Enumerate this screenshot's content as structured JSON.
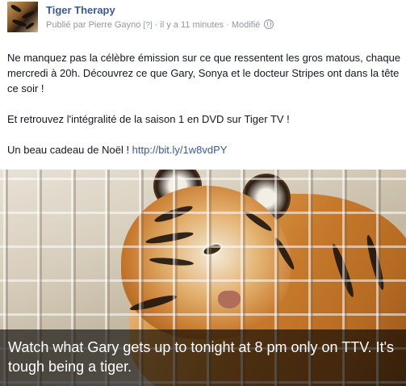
{
  "post": {
    "page_name": "Tiger Therapy",
    "published_by": "Publié par Pierre Gayno",
    "help_marker": "[?]",
    "time": "· il y a 11 minutes",
    "edited": "· Modifié",
    "privacy_icon": "globe-icon"
  },
  "body": {
    "paragraph_1": "Ne manquez pas la célèbre émission sur ce que ressentent les gros matous, chaque mercredi à 20h. Découvrez ce que Gary, Sonya et le docteur Stripes ont dans la tête ce soir !",
    "paragraph_2": "Et retrouvez l'intégralité de la saison 1 en DVD sur Tiger TV !",
    "paragraph_3_text": "Un beau cadeau de Noël ! ",
    "paragraph_3_link": "http://bit.ly/1w8vdPY"
  },
  "media": {
    "caption": "Watch what Gary gets up to tonight at 8 pm only on TTV. It's tough being a tiger."
  }
}
